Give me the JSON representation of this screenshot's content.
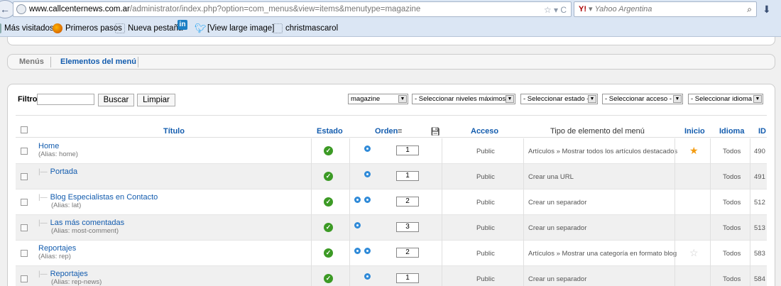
{
  "browser": {
    "url_domain": "www.callcenternews.com.ar",
    "url_path": "/administrator/index.php?option=com_menus&view=items&menutype=magazine",
    "search_engine": "Yahoo Argentina",
    "bookmarks": [
      "Más visitados",
      "Primeros pasos",
      "Nueva pestaña",
      "[View large image]",
      "christmascarol"
    ]
  },
  "tabs": {
    "menus": "Menús",
    "items": "Elementos del menú"
  },
  "filter": {
    "label": "Filtro:",
    "search_btn": "Buscar",
    "clear_btn": "Limpiar",
    "menu_select": "magazine",
    "levels_select": "- Seleccionar niveles máximos -",
    "state_select": "- Seleccionar estado -",
    "access_select": "- Seleccionar acceso -",
    "language_select": "- Seleccionar idioma -"
  },
  "columns": {
    "title": "Título",
    "state": "Estado",
    "order": "Orden",
    "access": "Acceso",
    "type": "Tipo de elemento del menú",
    "home": "Inicio",
    "language": "Idioma",
    "id": "ID"
  },
  "rows": [
    {
      "title": "Home",
      "alias": "(Alias: home)",
      "order": "1",
      "access": "Public",
      "type": "Artículos » Mostrar todos los artículos destacados",
      "home": "default",
      "language": "Todos",
      "id": "490"
    },
    {
      "title": "Portada",
      "alias": "",
      "order": "1",
      "access": "Public",
      "type": "Crear una URL",
      "home": "",
      "language": "Todos",
      "id": "491"
    },
    {
      "title": "Blog Especialistas en Contacto",
      "alias": "(Alias: lat)",
      "order": "2",
      "access": "Public",
      "type": "Crear un separador",
      "home": "",
      "language": "Todos",
      "id": "512"
    },
    {
      "title": "Las más comentadas",
      "alias": "(Alias: most-comment)",
      "order": "3",
      "access": "Public",
      "type": "Crear un separador",
      "home": "",
      "language": "Todos",
      "id": "513"
    },
    {
      "title": "Reportajes",
      "alias": "(Alias: rep)",
      "order": "2",
      "access": "Public",
      "type": "Artículos » Mostrar una categoría en formato blog",
      "home": "not-default",
      "language": "Todos",
      "id": "583"
    },
    {
      "title": "Reportajes",
      "alias": "(Alias: rep-news)",
      "order": "1",
      "access": "Public",
      "type": "Crear un separador",
      "home": "",
      "language": "Todos",
      "id": "584"
    }
  ]
}
